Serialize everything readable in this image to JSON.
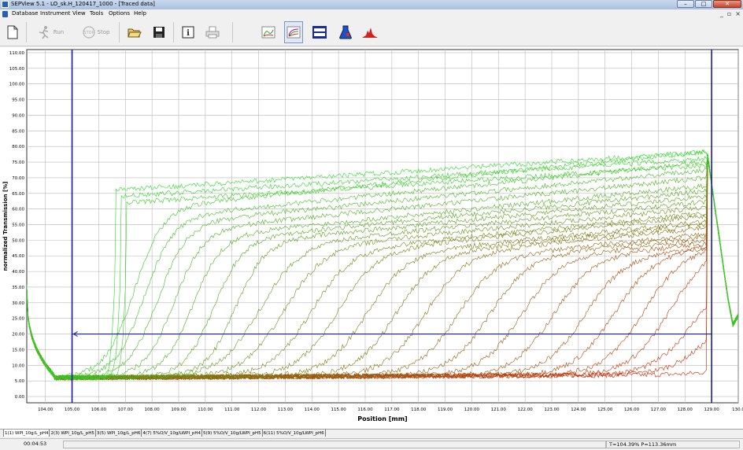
{
  "window": {
    "title": "SEPView 5.1 - LO_sk.H_120417_1000 - [Traced data]",
    "controls": [
      "–",
      "□",
      "✕"
    ],
    "mdi_controls": [
      "_",
      "▫",
      "×"
    ]
  },
  "menu": {
    "items": [
      "Database",
      "Instrument",
      "View",
      "Tools",
      "Options",
      "Help"
    ]
  },
  "toolbar": {
    "run_label": "Run",
    "stop_label": "Stop",
    "buttons": [
      "new-icon",
      "run-icon",
      "stop-icon",
      "open-icon",
      "save-icon",
      "info-icon",
      "print-icon",
      "profile-icon",
      "transmission-icon",
      "display-icon",
      "sample-icon",
      "histogram-icon"
    ]
  },
  "tabs": [
    "1(1) WPI_10g/L_pH4",
    "2(3) WPI_10g/L_pH5",
    "3(5) WPI_10g/L_pH6",
    "4(7) 5%O/V_10g/LWPI_pH4",
    "5(9) 5%O/V_10g/LWPI_pH5",
    "6(11) 5%O/V_10g/LWPI_pH6"
  ],
  "status": {
    "elapsed": "00:04:53",
    "readout": "T=104.39%   P=113.36mm"
  },
  "colors": {
    "early_profile": "#22dd22",
    "late_profile": "#cc2200",
    "cursor": "#1a1aaa",
    "grid": "#b8b8b8"
  },
  "chart_data": {
    "type": "line",
    "xlabel": "Position [mm]",
    "ylabel": "normalized Transmission [%]",
    "xlim": [
      103.3,
      130.0
    ],
    "ylim": [
      -2,
      111
    ],
    "x_ticks": [
      "104.00",
      "105.00",
      "106.00",
      "107.00",
      "108.00",
      "109.00",
      "110.00",
      "111.00",
      "112.00",
      "113.00",
      "114.00",
      "115.00",
      "116.00",
      "117.00",
      "118.00",
      "119.00",
      "120.00",
      "121.00",
      "122.00",
      "123.00",
      "124.00",
      "125.00",
      "126.00",
      "127.00",
      "128.00",
      "129.00",
      "130.0"
    ],
    "y_ticks": [
      "0.00",
      "5.00",
      "10.00",
      "15.00",
      "20.00",
      "25.00",
      "30.00",
      "35.00",
      "40.00",
      "45.00",
      "50.00",
      "55.00",
      "60.00",
      "65.00",
      "70.00",
      "75.00",
      "80.00",
      "85.00",
      "90.00",
      "95.00",
      "100.00",
      "105.00",
      "110.00"
    ],
    "grid": true,
    "legend": "none",
    "cursors": {
      "vertical_left_mm": 105.0,
      "vertical_right_mm": 129.0,
      "horizontal_level_pct": 20.0
    },
    "profile_fronts_mm": [
      106.6,
      106.8,
      107.0,
      107.3,
      107.7,
      108.2,
      108.8,
      109.5,
      110.3,
      111.1,
      112.0,
      112.9,
      113.9,
      114.9,
      116.0,
      117.1,
      118.2,
      119.4,
      120.6,
      121.8,
      123.0,
      124.2,
      125.3,
      126.4,
      127.4,
      128.3,
      128.9,
      130.0
    ],
    "profile_plateaus_pct": [
      66,
      64,
      62,
      60,
      57,
      55,
      53,
      51,
      50,
      49,
      48,
      47,
      46,
      46,
      45,
      45,
      45,
      44,
      44,
      44,
      44,
      44,
      45,
      46,
      47,
      40,
      30,
      12
    ]
  }
}
